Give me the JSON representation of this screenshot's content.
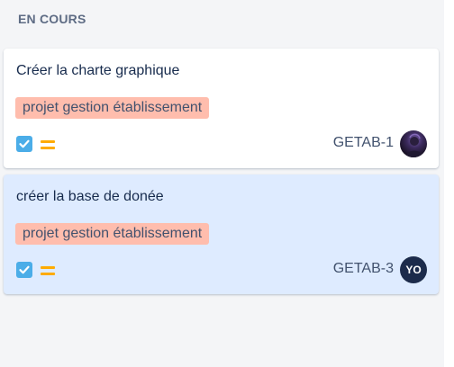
{
  "column": {
    "title": "EN COURS"
  },
  "cards": [
    {
      "title": "Créer la charte graphique",
      "epic": "projet gestion établissement",
      "key": "GETAB-1",
      "issue_type_icon": "task-checkbox-icon",
      "priority_icon": "medium-priority-icon",
      "assignee_avatar": "user-photo",
      "selected": false
    },
    {
      "title": "créer la base de donée",
      "epic": "projet gestion établissement",
      "key": "GETAB-3",
      "issue_type_icon": "task-checkbox-icon",
      "priority_icon": "medium-priority-icon",
      "assignee_initials": "YO",
      "selected": true
    }
  ],
  "colors": {
    "background": "#f4f5f7",
    "card": "#ffffff",
    "card_selected": "#deebff",
    "epic_lozenge": "#ffbdad",
    "task_icon": "#4bade8",
    "priority_medium": "#ffab00",
    "avatar_initials_bg": "#1c2b4b"
  }
}
